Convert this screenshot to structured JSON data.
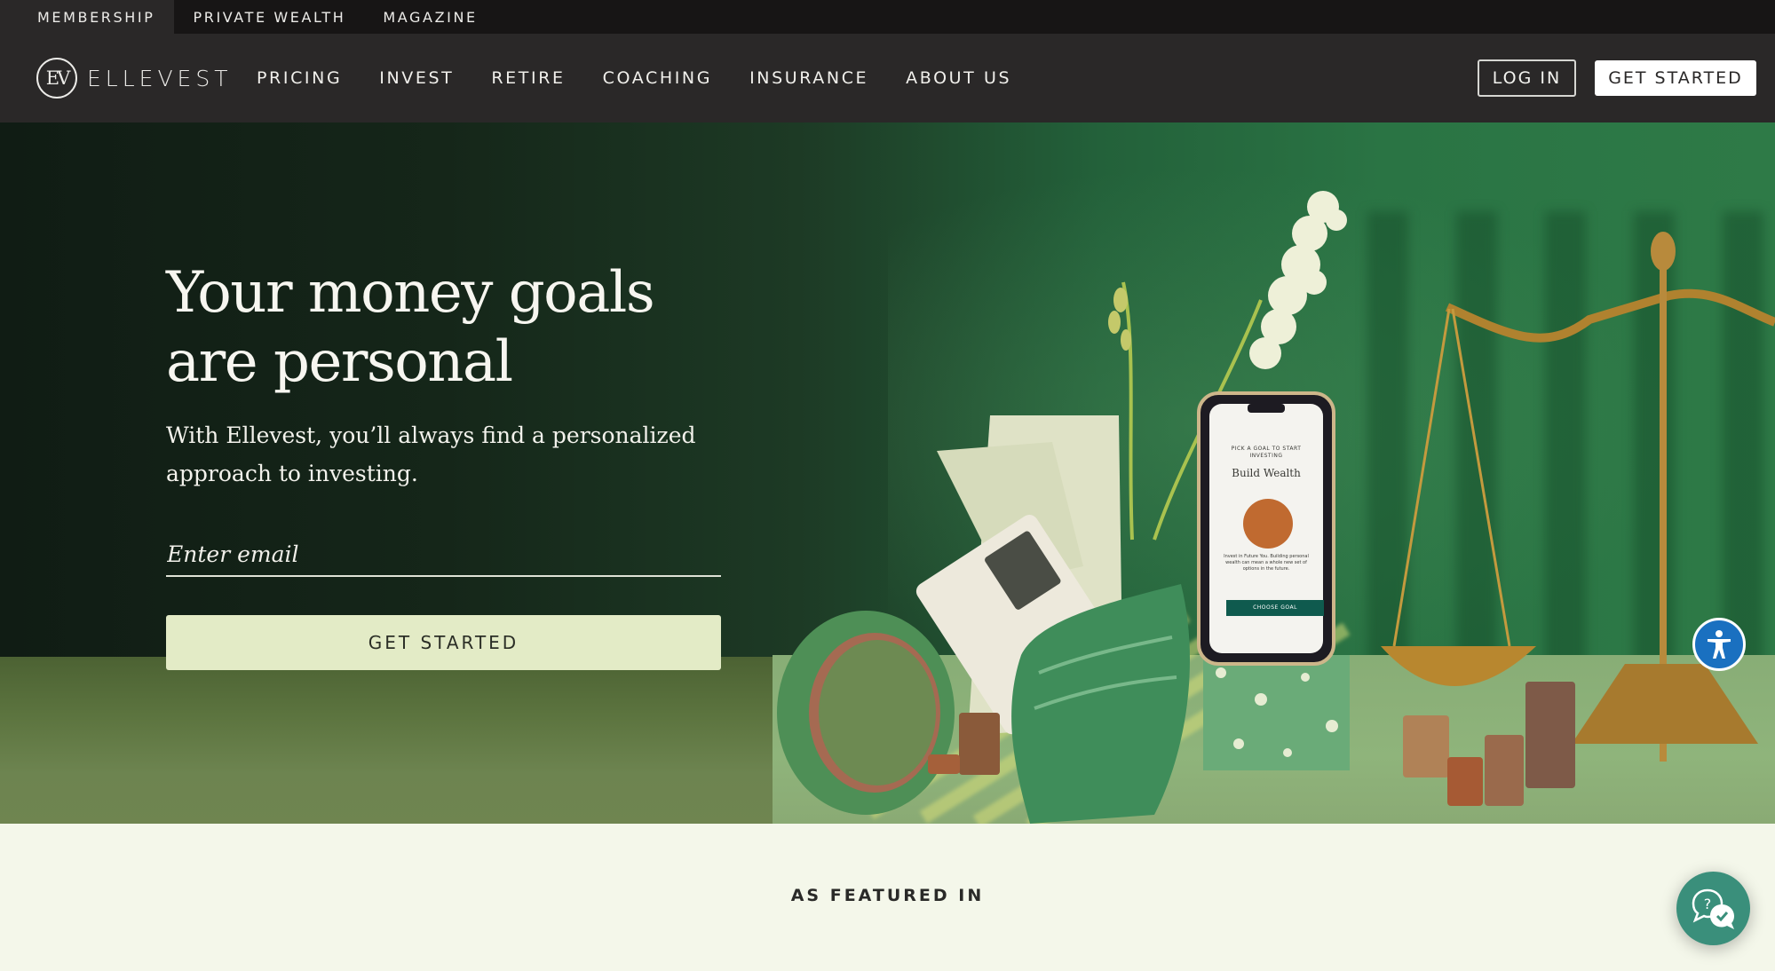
{
  "utility_nav": {
    "items": [
      {
        "label": "MEMBERSHIP",
        "active": true
      },
      {
        "label": "PRIVATE WEALTH",
        "active": false
      },
      {
        "label": "MAGAZINE",
        "active": false
      }
    ]
  },
  "main_nav": {
    "logo_mark": "EV",
    "logo_text": "ELLEVEST",
    "links": [
      "PRICING",
      "INVEST",
      "RETIRE",
      "COACHING",
      "INSURANCE",
      "ABOUT US"
    ],
    "login_label": "LOG IN",
    "get_started_label": "GET STARTED"
  },
  "hero": {
    "title_line1": "Your money goals",
    "title_line2": "are personal",
    "subtitle": "With Ellevest, you’ll always find a personalized approach to investing.",
    "email_placeholder": "Enter email",
    "email_value": "",
    "cta_label": "GET STARTED",
    "phone_screen": {
      "eyebrow": "PICK A GOAL TO START INVESTING",
      "heading": "Build Wealth",
      "body": "Invest in Future You. Building personal wealth can mean a whole new set of options in the future.",
      "button": "CHOOSE GOAL"
    }
  },
  "accessibility_widget": {
    "icon": "accessibility-icon",
    "color": "#1a70c0"
  },
  "featured": {
    "title": "AS FEATURED IN"
  },
  "help_chat": {
    "icon": "help-chat-icon",
    "color": "#3a8f7b"
  },
  "colors": {
    "nav_bg": "#2a2828",
    "utility_bg": "#171515",
    "cta_bg": "#e3ebc6",
    "page_bg": "#f4f7ea",
    "phone_button": "#0f5a4e"
  }
}
